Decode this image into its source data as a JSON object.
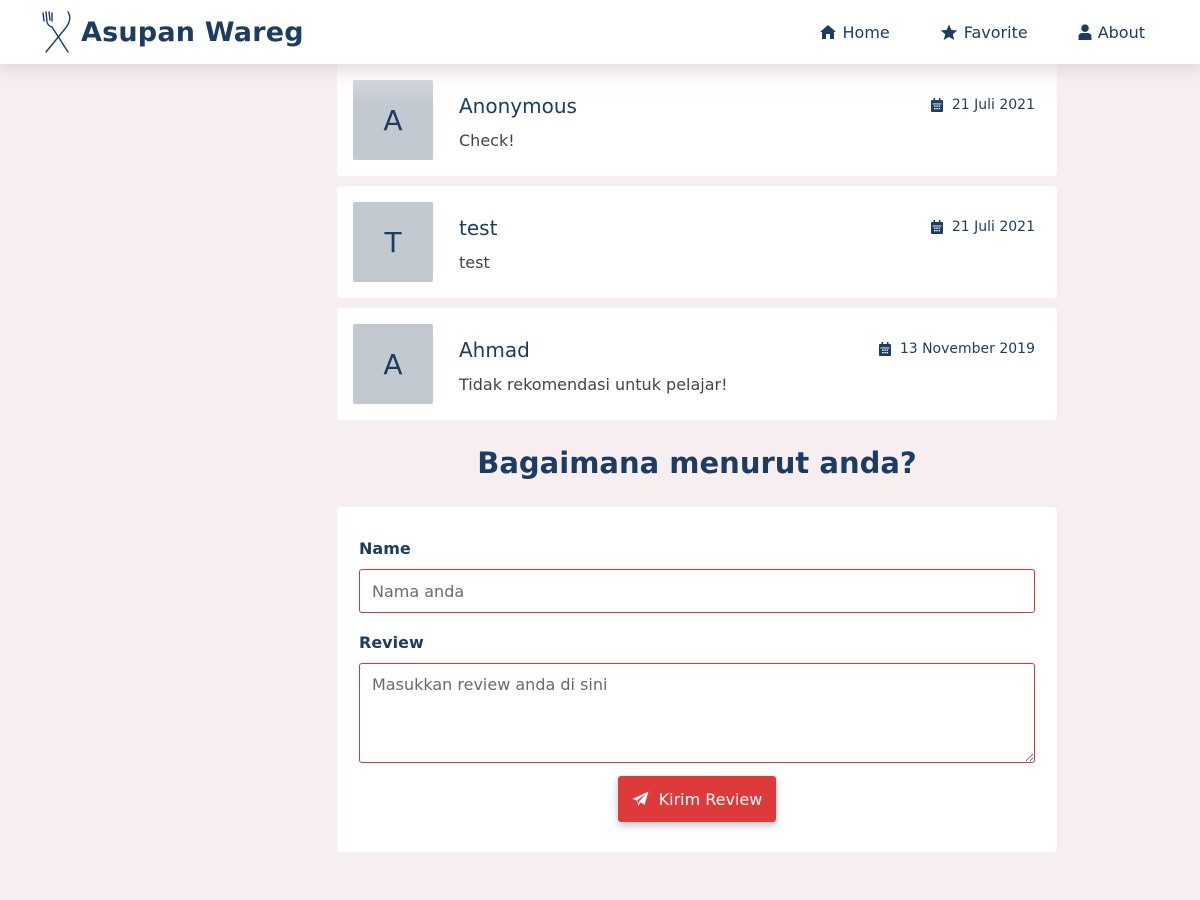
{
  "header": {
    "title": "Asupan Wareg",
    "logo_icon": "fork-knife-icon",
    "nav": [
      {
        "label": "Home",
        "icon": "home-icon"
      },
      {
        "label": "Favorite",
        "icon": "star-icon"
      },
      {
        "label": "About",
        "icon": "user-icon"
      }
    ]
  },
  "reviews": [
    {
      "initial": "A",
      "name": "Anonymous",
      "date": "21 Juli 2021",
      "text": "Check!"
    },
    {
      "initial": "T",
      "name": "test",
      "date": "21 Juli 2021",
      "text": "test"
    },
    {
      "initial": "A",
      "name": "Ahmad",
      "date": "13 November 2019",
      "text": "Tidak rekomendasi untuk pelajar!"
    }
  ],
  "form": {
    "title": "Bagaimana menurut anda?",
    "name_label": "Name",
    "name_placeholder": "Nama anda",
    "review_label": "Review",
    "review_placeholder": "Masukkan review anda di sini",
    "submit_label": "Kirim Review",
    "submit_icon": "paper-plane-icon"
  },
  "colors": {
    "primary": "#1b3d63",
    "accent": "#df3a3a",
    "background": "#f7eef0",
    "avatar": "#c3c9d1"
  }
}
